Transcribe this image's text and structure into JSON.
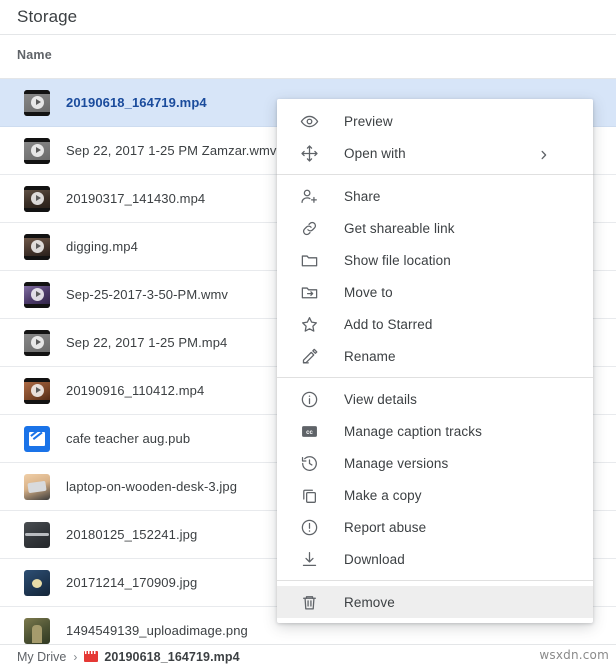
{
  "header": {
    "title": "Storage",
    "column_name": "Name"
  },
  "files": [
    {
      "name": "20190618_164719.mp4",
      "thumb": "video-thumb-grey",
      "style": "t-grey",
      "kind": "video",
      "selected": true
    },
    {
      "name": "Sep 22, 2017 1-25 PM Zamzar.wmv",
      "thumb": "video-thumb-grey",
      "style": "t-grey",
      "kind": "video",
      "selected": false
    },
    {
      "name": "20190317_141430.mp4",
      "thumb": "video-thumb-dark",
      "style": "t-dark1",
      "kind": "video",
      "selected": false
    },
    {
      "name": "digging.mp4",
      "thumb": "video-thumb-dark",
      "style": "t-dark2",
      "kind": "video",
      "selected": false
    },
    {
      "name": "Sep-25-2017-3-50-PM.wmv",
      "thumb": "video-thumb-purple",
      "style": "t-purp",
      "kind": "video",
      "selected": false
    },
    {
      "name": "Sep 22, 2017 1-25 PM.mp4",
      "thumb": "video-thumb-grey",
      "style": "t-grey",
      "kind": "video",
      "selected": false
    },
    {
      "name": "20190916_110412.mp4",
      "thumb": "video-thumb-brown",
      "style": "t-brown",
      "kind": "video",
      "selected": false
    },
    {
      "name": "cafe teacher aug.pub",
      "thumb": "publisher-doc-thumb",
      "style": "t-blue",
      "kind": "doc",
      "selected": false
    },
    {
      "name": "laptop-on-wooden-desk-3.jpg",
      "thumb": "image-thumb-laptop",
      "style": "t-desk",
      "kind": "img-laptop",
      "selected": false
    },
    {
      "name": "20180125_152241.jpg",
      "thumb": "image-thumb-road",
      "style": "t-road",
      "kind": "img-line",
      "selected": false
    },
    {
      "name": "20171214_170909.jpg",
      "thumb": "image-thumb-ocean",
      "style": "t-ocean",
      "kind": "img-ball",
      "selected": false
    },
    {
      "name": "1494549139_uploadimage.png",
      "thumb": "image-thumb-person",
      "style": "t-army",
      "kind": "img-figure",
      "selected": false
    }
  ],
  "context_menu": {
    "groups": [
      {
        "items": [
          {
            "label": "Preview",
            "icon": "eye-icon",
            "submenu": false,
            "highlighted": false
          },
          {
            "label": "Open with",
            "icon": "open-with-icon",
            "submenu": true,
            "highlighted": false
          }
        ]
      },
      {
        "items": [
          {
            "label": "Share",
            "icon": "person-add-icon",
            "submenu": false,
            "highlighted": false
          },
          {
            "label": "Get shareable link",
            "icon": "link-icon",
            "submenu": false,
            "highlighted": false
          },
          {
            "label": "Show file location",
            "icon": "folder-icon",
            "submenu": false,
            "highlighted": false
          },
          {
            "label": "Move to",
            "icon": "move-to-folder-icon",
            "submenu": false,
            "highlighted": false
          },
          {
            "label": "Add to Starred",
            "icon": "star-icon",
            "submenu": false,
            "highlighted": false
          },
          {
            "label": "Rename",
            "icon": "pencil-icon",
            "submenu": false,
            "highlighted": false
          }
        ]
      },
      {
        "items": [
          {
            "label": "View details",
            "icon": "info-circle-icon",
            "submenu": false,
            "highlighted": false
          },
          {
            "label": "Manage caption tracks",
            "icon": "closed-caption-icon",
            "submenu": false,
            "highlighted": false
          },
          {
            "label": "Manage versions",
            "icon": "history-icon",
            "submenu": false,
            "highlighted": false
          },
          {
            "label": "Make a copy",
            "icon": "copy-icon",
            "submenu": false,
            "highlighted": false
          },
          {
            "label": "Report abuse",
            "icon": "exclamation-circle-icon",
            "submenu": false,
            "highlighted": false
          },
          {
            "label": "Download",
            "icon": "download-icon",
            "submenu": false,
            "highlighted": false
          }
        ]
      },
      {
        "items": [
          {
            "label": "Remove",
            "icon": "trash-icon",
            "submenu": false,
            "highlighted": true
          }
        ]
      }
    ]
  },
  "breadcrumb": {
    "root": "My Drive",
    "separator": "›",
    "current": "20190618_164719.mp4"
  },
  "watermark": "wsxdn.com",
  "colors": {
    "selected_row_bg": "#d7e5f8",
    "selected_row_text": "#1a4b9c",
    "menu_highlight_bg": "#eeeeee",
    "text_primary": "#3c4043",
    "text_secondary": "#5f6368",
    "divider": "#e8eaed"
  }
}
